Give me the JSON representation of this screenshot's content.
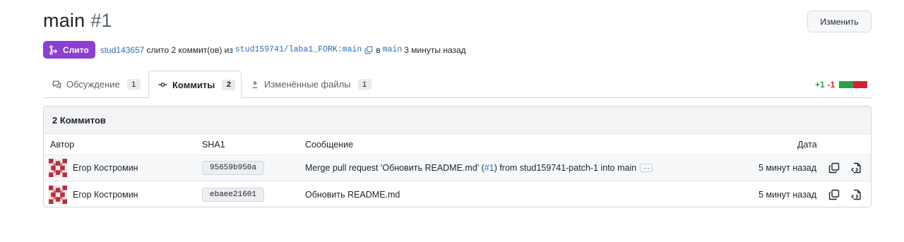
{
  "header": {
    "title": "main",
    "number": "#1",
    "edit_button": "Изменить"
  },
  "meta": {
    "status_badge": "Слито",
    "user": "stud143657",
    "merged_text": "слито 2 коммит(ов) из",
    "source_branch": "stud159741/laba1_FORK:main",
    "into_text": "в",
    "target_branch": "main",
    "time": "3 минуты назад"
  },
  "tabs": [
    {
      "label": "Обсуждение",
      "count": "1",
      "icon": "comment-icon"
    },
    {
      "label": "Коммиты",
      "count": "2",
      "icon": "commit-icon"
    },
    {
      "label": "Изменённые файлы",
      "count": "1",
      "icon": "plus-minus-icon"
    }
  ],
  "diffstat": {
    "additions": "+1",
    "deletions": "-1",
    "colors": {
      "add": "#2ea043",
      "del": "#d1242f"
    }
  },
  "commits": {
    "heading": "2 Коммитов",
    "columns": {
      "author": "Автор",
      "sha": "SHA1",
      "message": "Сообщение",
      "date": "Дата"
    },
    "rows": [
      {
        "author": "Егор Костромин",
        "sha": "95659b950a",
        "message_pre": "Merge pull request 'Обновить README.md' (",
        "message_link": "#1",
        "message_post": ") from stud159741-patch-1 into main",
        "ellipsis": "···",
        "date": "5 минут назад"
      },
      {
        "author": "Егор Костромин",
        "sha": "ebaee21601",
        "message_pre": "Обновить README.md",
        "message_link": "",
        "message_post": "",
        "ellipsis": "",
        "date": "5 минут назад"
      }
    ]
  },
  "colors": {
    "accent": "#8c3fd0",
    "link": "#2f6fb5"
  }
}
